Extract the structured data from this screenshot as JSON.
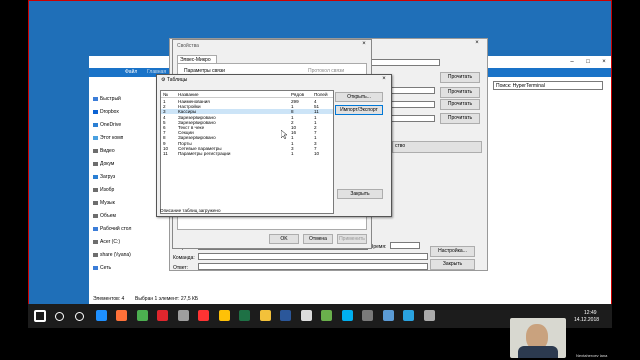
{
  "explorer": {
    "tabs": [
      "Файл",
      "Главная"
    ],
    "search": "Поиск: HyperTerminal",
    "nav": [
      {
        "label": "Быстрый",
        "icon": "star-icon",
        "color": "#3b7dd8"
      },
      {
        "label": "Dropbox",
        "icon": "dropbox-icon",
        "color": "#0b62d3"
      },
      {
        "label": "OneDrive",
        "icon": "cloud-icon",
        "color": "#2a7fd4"
      },
      {
        "label": "Этот комп",
        "icon": "computer-icon",
        "color": "#4aa0e0"
      },
      {
        "label": "Видео",
        "icon": "video-icon",
        "color": "#6d6d6d"
      },
      {
        "label": "Докум",
        "icon": "document-icon",
        "color": "#6d6d6d"
      },
      {
        "label": "Загруз",
        "icon": "download-icon",
        "color": "#2a7fd4"
      },
      {
        "label": "Изобр",
        "icon": "image-icon",
        "color": "#6d6d6d"
      },
      {
        "label": "Музык",
        "icon": "music-icon",
        "color": "#6d6d6d"
      },
      {
        "label": "Объем",
        "icon": "cube-icon",
        "color": "#6d6d6d"
      },
      {
        "label": "Рабочий стол",
        "icon": "desktop-icon",
        "color": "#3b7dd8"
      },
      {
        "label": "Acer (C:)",
        "icon": "drive-icon",
        "color": "#6d6d6d"
      },
      {
        "label": "share (\\\\yana)",
        "icon": "network-drive-icon",
        "color": "#6d6d6d"
      },
      {
        "label": "Сеть",
        "icon": "network-icon",
        "color": "#3b7dd8"
      }
    ],
    "status_items": "Элементов: 4",
    "status_selected": "Выбран 1 элемент: 27,5 КБ"
  },
  "hyper": {
    "read_buttons": [
      "Прочитать",
      "Прочитать",
      "Прочитать",
      "Прочитать"
    ],
    "property_label": "ство",
    "time_label": "Время:",
    "settings_button": "Настройка...",
    "close_button": "Закрыть",
    "response_label": "Вопрос:",
    "command_label": "Команда:",
    "answer_label": "Ответ:"
  },
  "props": {
    "title": "Свойства",
    "tab": "Элвес-Микро",
    "group": "Параметры связи",
    "group2": "Протокол связи",
    "ok": "OK",
    "cancel": "Отмена",
    "apply": "Применить"
  },
  "tables": {
    "title": "Таблицы",
    "columns": [
      "№",
      "Название",
      "Рядов",
      "Полей"
    ],
    "rows": [
      [
        "1",
        "Наименования",
        "299",
        "4"
      ],
      [
        "2",
        "Настройки",
        "1",
        "51"
      ],
      [
        "3",
        "Кассиры",
        "8",
        "11"
      ],
      [
        "4",
        "Зарезервировано",
        "1",
        "1"
      ],
      [
        "5",
        "Зарезервировано",
        "2",
        "1"
      ],
      [
        "6",
        "Текст в чеке",
        "10",
        "2"
      ],
      [
        "7",
        "Секции",
        "16",
        "7"
      ],
      [
        "8",
        "Зарезервировано",
        "1",
        "1"
      ],
      [
        "9",
        "Порты",
        "1",
        "3"
      ],
      [
        "10",
        "Сетевые параметры",
        "3",
        "7"
      ],
      [
        "11",
        "Параметры регистрации",
        "1",
        "10"
      ]
    ],
    "selected_row": 2,
    "open_button": "Открыть...",
    "import_button": "Импорт/Экспорт",
    "close_button": "Закрыть",
    "status": "Описание таблиц загружено"
  },
  "taskbar": {
    "time": "12:49",
    "date": "14.12.2018",
    "icons": [
      {
        "name": "start-icon",
        "color": "#ffffff"
      },
      {
        "name": "search-icon",
        "color": "#ffffff"
      },
      {
        "name": "task-view-icon",
        "color": "#ffffff"
      },
      {
        "name": "edge-icon",
        "color": "#1e90ff"
      },
      {
        "name": "firefox-icon",
        "color": "#ff7139"
      },
      {
        "name": "chrome-icon",
        "color": "#4caf50"
      },
      {
        "name": "opera-icon",
        "color": "#e0262d"
      },
      {
        "name": "terminal-icon",
        "color": "#9e9e9e"
      },
      {
        "name": "yandex-icon",
        "color": "#ff3333"
      },
      {
        "name": "mail-icon",
        "color": "#ffc107"
      },
      {
        "name": "excel-icon",
        "color": "#1e7145"
      },
      {
        "name": "folder-icon",
        "color": "#f3c13a"
      },
      {
        "name": "word-icon",
        "color": "#2b579a"
      },
      {
        "name": "calculator-icon",
        "color": "#dddddd"
      },
      {
        "name": "tool-icon",
        "color": "#6ab04c"
      },
      {
        "name": "skype-icon",
        "color": "#00aff0"
      },
      {
        "name": "app-icon",
        "color": "#7a7a7a"
      },
      {
        "name": "app2-icon",
        "color": "#5b9bd5"
      },
      {
        "name": "telegram-icon",
        "color": "#2aa3e0"
      },
      {
        "name": "app3-icon",
        "color": "#aaaaaa"
      }
    ]
  },
  "webcam": {
    "caption": "Nextaheroev lana"
  }
}
